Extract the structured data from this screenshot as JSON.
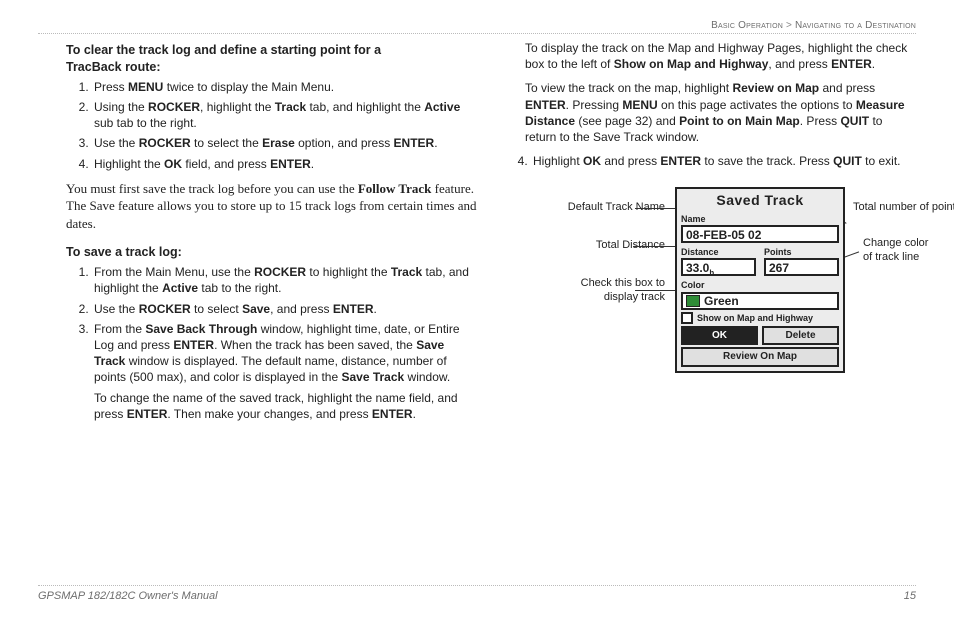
{
  "breadcrumb": {
    "left": "Basic Operation",
    "sep": ">",
    "right": "Navigating to a Destination"
  },
  "left": {
    "head1_a": "To clear the track log and define a starting point for a",
    "head1_b": "TracBack route:",
    "l1_1a": "Press ",
    "l1_1b": "MENU",
    "l1_1c": " twice to display the Main Menu.",
    "l1_2a": "Using the ",
    "l1_2b": "ROCKER",
    "l1_2c": ", highlight the ",
    "l1_2d": "Track",
    "l1_2e": " tab, and highlight the ",
    "l1_2f": "Active",
    "l1_2g": " sub tab to the right.",
    "l1_3a": "Use the ",
    "l1_3b": "ROCKER",
    "l1_3c": " to select the ",
    "l1_3d": "Erase",
    "l1_3e": " option, and press ",
    "l1_3f": "ENTER",
    "l1_3g": ".",
    "l1_4a": "Highlight the ",
    "l1_4b": "OK",
    "l1_4c": " field, and press ",
    "l1_4d": "ENTER",
    "l1_4e": ".",
    "serif_a": "You must first save the track log before you can use the ",
    "serif_b": "Follow Track",
    "serif_c": " feature. The Save feature allows you to store up to 15 track logs from certain times and dates.",
    "head2": "To save a track log:",
    "l2_1a": "From the Main Menu, use the ",
    "l2_1b": "ROCKER",
    "l2_1c": " to highlight the ",
    "l2_1d": "Track",
    "l2_1e": " tab, and highlight the ",
    "l2_1f": "Active",
    "l2_1g": " tab to the right.",
    "l2_2a": "Use the ",
    "l2_2b": "ROCKER",
    "l2_2c": " to select ",
    "l2_2d": "Save",
    "l2_2e": ", and press ",
    "l2_2f": "ENTER",
    "l2_2g": ".",
    "l2_3a": "From the ",
    "l2_3b": "Save Back Through",
    "l2_3c": " window, highlight time, date, or Entire Log and press ",
    "l2_3d": "ENTER",
    "l2_3e": ". When the track has been saved, the ",
    "l2_3f": "Save Track",
    "l2_3g": " window is displayed. The default name, distance, number of points (500 max), and color is displayed in the ",
    "l2_3h": "Save Track",
    "l2_3i": " window.",
    "l2_3_sub_a": "To change the name of the saved track, highlight the name field, and press ",
    "l2_3_sub_b": "ENTER",
    "l2_3_sub_c": ". Then make your changes, and press ",
    "l2_3_sub_d": "ENTER",
    "l2_3_sub_e": "."
  },
  "right": {
    "p1a": "To display the track on the Map and Highway Pages, highlight the check box to the left of ",
    "p1b": "Show on Map and Highway",
    "p1c": ", and press ",
    "p1d": "ENTER",
    "p1e": ".",
    "p2a": "To view the track on the map, highlight ",
    "p2b": "Review on Map",
    "p2c": " and press ",
    "p2d": "ENTER",
    "p2e": ". Pressing ",
    "p2f": "MENU",
    "p2g": " on this page activates the options to ",
    "p2h": "Measure Distance",
    "p2i": " (see page 32) and ",
    "p2j": "Point to on Main Map",
    "p2k": ". Press ",
    "p2l": "QUIT",
    "p2m": " to return to the Save Track window.",
    "l4a": "Highlight ",
    "l4b": "OK",
    "l4c": " and press ",
    "l4d": "ENTER",
    "l4e": " to save the track. Press ",
    "l4f": "QUIT",
    "l4g": " to exit."
  },
  "device": {
    "title": "Saved Track",
    "name_label": "Name",
    "name_value": "08-FEB-05 02",
    "distance_label": "Distance",
    "distance_value": "33.0",
    "distance_unit": "h",
    "points_label": "Points",
    "points_value": "267",
    "color_label": "Color",
    "color_value": "Green",
    "checkbox_label": "Show on Map and Highway",
    "ok": "OK",
    "delete": "Delete",
    "review": "Review On Map"
  },
  "callouts": {
    "default_name": "Default Track Name",
    "total_distance": "Total Distance",
    "check_box_a": "Check this box to",
    "check_box_b": "display track",
    "total_points": "Total number of points",
    "change_color_a": "Change color",
    "change_color_b": "of track line"
  },
  "footer": {
    "manual": "GPSMAP 182/182C Owner's Manual",
    "page": "15"
  }
}
